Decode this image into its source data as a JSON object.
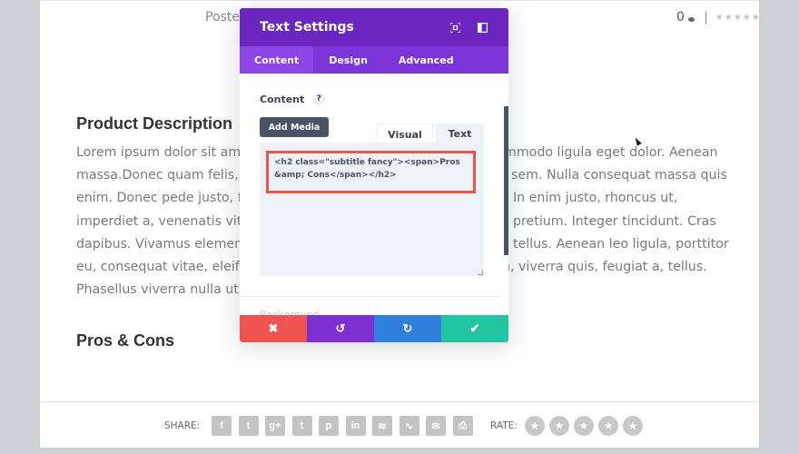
{
  "post_meta": {
    "label": "Poste",
    "comment_count": "0",
    "rating_stars": "★★★★★"
  },
  "sections": {
    "product_description_title": "Product Description",
    "pros_cons_title": "Pros & Cons"
  },
  "body_lines": [
    [
      "Lorem ipsum dolor sit ame",
      "mmodo ligula eget dolor. Aenean"
    ],
    [
      "massa.Donec quam felis, u",
      "sem. Nulla consequat massa quis"
    ],
    [
      "enim. Donec pede justo, fr",
      "In enim justo, rhoncus ut,"
    ],
    [
      "imperdiet a, venenatis vita",
      "pretium. Integer tincidunt. Cras"
    ],
    [
      "dapibus. Vivamus element",
      "tellus. Aenean leo ligula, porttitor"
    ],
    [
      "eu, consequat vitae, eleife",
      "n, viverra quis, feugiat a, tellus."
    ],
    [
      "Phasellus viverra nulla ut r",
      ""
    ]
  ],
  "modal": {
    "title": "Text Settings",
    "header_icons": [
      "focus-icon",
      "sidebar-layout-icon"
    ],
    "tabs": [
      {
        "label": "Content",
        "active": true
      },
      {
        "label": "Design",
        "active": false
      },
      {
        "label": "Advanced",
        "active": false
      }
    ],
    "content_label": "Content",
    "help": "?",
    "add_media": "Add Media",
    "editor_tabs": {
      "visual": "Visual",
      "text": "Text"
    },
    "editor_value": "<h2 class=\"subtitle fancy\"><span>Pros &amp; Cons</span></h2>",
    "faded_label": "Background",
    "footer": {
      "cancel": "✖",
      "undo": "↺",
      "redo": "↻",
      "save": "✔"
    },
    "colors": {
      "header": "#6c26c0",
      "tabs": "#7b35d8",
      "cancel": "#ef5350",
      "undo": "#7e2fd0",
      "redo": "#2f7fdc",
      "save": "#21c5a1",
      "highlight": "#e8554e"
    }
  },
  "share": {
    "label": "SHARE:",
    "icons": [
      {
        "name": "facebook-icon",
        "glyph": "f"
      },
      {
        "name": "twitter-icon",
        "glyph": "t"
      },
      {
        "name": "google-plus-icon",
        "glyph": "g+"
      },
      {
        "name": "tumblr-icon",
        "glyph": "t"
      },
      {
        "name": "pinterest-icon",
        "glyph": "p"
      },
      {
        "name": "linkedin-icon",
        "glyph": "in"
      },
      {
        "name": "buffer-icon",
        "glyph": "≋"
      },
      {
        "name": "stumbleupon-icon",
        "glyph": "∿"
      },
      {
        "name": "email-icon",
        "glyph": "✉"
      },
      {
        "name": "print-icon",
        "glyph": "⎙"
      }
    ]
  },
  "rate": {
    "label": "RATE:",
    "star_glyph": "★",
    "stars": 5
  }
}
